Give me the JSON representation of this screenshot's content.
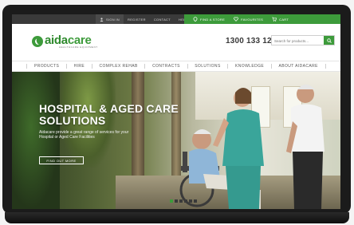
{
  "topbar": {
    "links": [
      "Sign In",
      "Register",
      "Contact",
      "Help"
    ],
    "actions": [
      {
        "label": "Find a Store",
        "icon": "map-pin-icon"
      },
      {
        "label": "Favourites",
        "icon": "heart-icon"
      },
      {
        "label": "Cart",
        "icon": "cart-icon"
      }
    ]
  },
  "header": {
    "logo_name_1": "aida",
    "logo_name_2": "care",
    "logo_tagline": "Healthcare Equipment",
    "phone": "1300 133 120",
    "search_placeholder": "Search for products..."
  },
  "nav": [
    "Products",
    "Hire",
    "Complex Rehab",
    "Contracts",
    "Solutions",
    "Knowledge",
    "About Aidacare"
  ],
  "hero": {
    "title": "Hospital & Aged Care Solutions",
    "subtitle": "Aidacare provide a great range of services for your Hospital or Aged Care Facilities",
    "button": "Find out more",
    "slides": 6,
    "active_slide": 1
  },
  "colors": {
    "brand_green": "#3d9b3b",
    "topbar_dark": "#3a3a3a"
  }
}
